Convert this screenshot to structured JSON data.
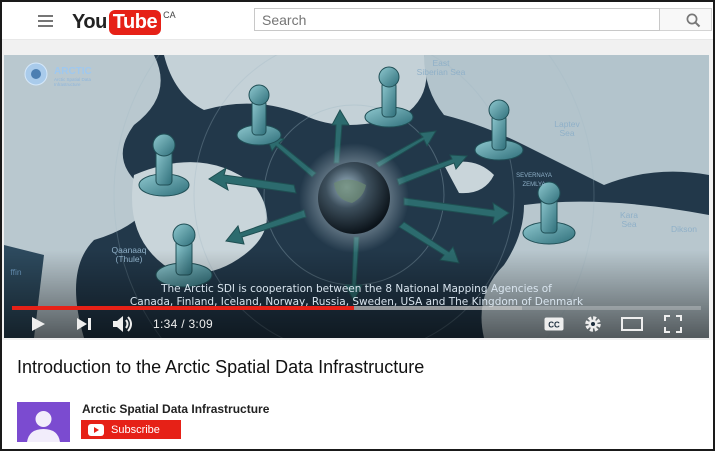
{
  "header": {
    "logo_you": "You",
    "logo_tube": "Tube",
    "logo_region": "CA",
    "search_placeholder": "Search"
  },
  "player": {
    "watermark_title": "ARCTIC",
    "watermark_subtitle": "Arctic Spatial Data Infrastructure",
    "caption_line1": "The Arctic SDI is cooperation between the 8 National Mapping Agencies of",
    "caption_line2": "Canada, Finland, Iceland, Norway, Russia, Sweden, USA and The Kingdom of Denmark",
    "map_labels": {
      "east_siberian": "East Siberian Sea",
      "laptev": "Laptev Sea",
      "severnaya": "SEVERNAYA ZEMLYA",
      "kara": "Kara Sea",
      "dikson": "Dikson",
      "qaanaaq": "Qaanaaq (Thule)",
      "baffin": "ffin"
    },
    "current_time": "1:34",
    "duration": "3:09",
    "time_display": "1:34 / 3:09",
    "progress_fraction": 0.497,
    "buffered_fraction": 0.74,
    "colors": {
      "progress": "#e62117",
      "buffered": "#c8c8c8"
    }
  },
  "video": {
    "title": "Introduction to the Arctic Spatial Data Infrastructure",
    "channel_name": "Arctic Spatial Data Infrastructure",
    "subscribe_label": "Subscribe"
  },
  "icons": [
    "menu-icon",
    "search-icon",
    "play-icon",
    "next-icon",
    "volume-icon",
    "captions-icon",
    "settings-icon",
    "theater-icon",
    "fullscreen-icon"
  ]
}
